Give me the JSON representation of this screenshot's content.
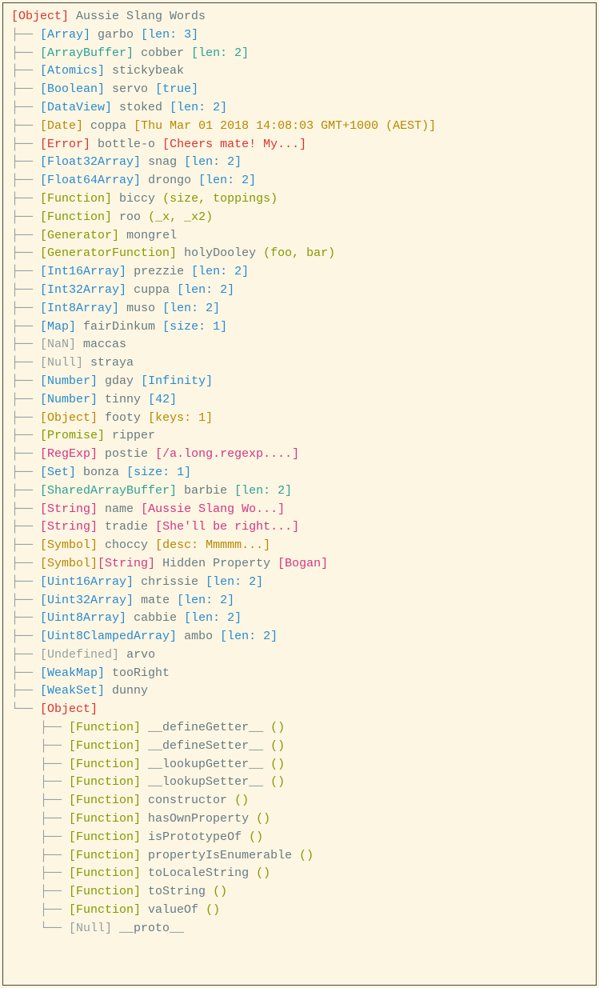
{
  "root": {
    "type": "[Object]",
    "label": "Aussie Slang Words"
  },
  "rows": [
    {
      "tree": "├── ",
      "typeClass": "type-array",
      "type": "[Array]",
      "key": "garbo",
      "valClass": "val-array",
      "val": "[len: 3]"
    },
    {
      "tree": "├── ",
      "typeClass": "type-arraybuffer",
      "type": "[ArrayBuffer]",
      "key": "cobber",
      "valClass": "val-buffer",
      "val": "[len: 2]"
    },
    {
      "tree": "├── ",
      "typeClass": "type-atomics",
      "type": "[Atomics]",
      "key": "stickybeak"
    },
    {
      "tree": "├── ",
      "typeClass": "type-boolean",
      "type": "[Boolean]",
      "key": "servo",
      "valClass": "val-bool",
      "val": "[true]"
    },
    {
      "tree": "├── ",
      "typeClass": "type-dataview",
      "type": "[DataView]",
      "key": "stoked",
      "valClass": "val-array",
      "val": "[len: 2]"
    },
    {
      "tree": "├── ",
      "typeClass": "type-date",
      "type": "[Date]",
      "key": "coppa",
      "valClass": "val-date",
      "val": "[Thu Mar 01 2018 14:08:03 GMT+1000 (AEST)]"
    },
    {
      "tree": "├── ",
      "typeClass": "type-error",
      "type": "[Error]",
      "key": "bottle-o",
      "valClass": "val-error",
      "val": "[Cheers mate! My...]"
    },
    {
      "tree": "├── ",
      "typeClass": "type-typed",
      "type": "[Float32Array]",
      "key": "snag",
      "valClass": "val-array",
      "val": "[len: 2]"
    },
    {
      "tree": "├── ",
      "typeClass": "type-typed",
      "type": "[Float64Array]",
      "key": "drongo",
      "valClass": "val-array",
      "val": "[len: 2]"
    },
    {
      "tree": "├── ",
      "typeClass": "type-func",
      "type": "[Function]",
      "key": "biccy",
      "argsClass": "args",
      "args": "(size, toppings)"
    },
    {
      "tree": "├── ",
      "typeClass": "type-func",
      "type": "[Function]",
      "key": "roo",
      "argsClass": "args",
      "args": "(_x, _x2)"
    },
    {
      "tree": "├── ",
      "typeClass": "type-gen",
      "type": "[Generator]",
      "key": "mongrel"
    },
    {
      "tree": "├── ",
      "typeClass": "type-gen",
      "type": "[GeneratorFunction]",
      "key": "holyDooley",
      "argsClass": "args",
      "args": "(foo, bar)"
    },
    {
      "tree": "├── ",
      "typeClass": "type-typed",
      "type": "[Int16Array]",
      "key": "prezzie",
      "valClass": "val-array",
      "val": "[len: 2]"
    },
    {
      "tree": "├── ",
      "typeClass": "type-typed",
      "type": "[Int32Array]",
      "key": "cuppa",
      "valClass": "val-array",
      "val": "[len: 2]"
    },
    {
      "tree": "├── ",
      "typeClass": "type-typed",
      "type": "[Int8Array]",
      "key": "muso",
      "valClass": "val-array",
      "val": "[len: 2]"
    },
    {
      "tree": "├── ",
      "typeClass": "type-map",
      "type": "[Map]",
      "key": "fairDinkum",
      "valClass": "val-array",
      "val": "[size: 1]"
    },
    {
      "tree": "├── ",
      "typeClass": "type-nan",
      "type": "[NaN]",
      "key": "maccas"
    },
    {
      "tree": "├── ",
      "typeClass": "type-null",
      "type": "[Null]",
      "key": "straya"
    },
    {
      "tree": "├── ",
      "typeClass": "type-number",
      "type": "[Number]",
      "key": "gday",
      "valClass": "val-num",
      "val": "[Infinity]"
    },
    {
      "tree": "├── ",
      "typeClass": "type-number",
      "type": "[Number]",
      "key": "tinny",
      "valClass": "val-num",
      "val": "[42]"
    },
    {
      "tree": "├── ",
      "typeClass": "type-date",
      "type": "[Object]",
      "key": "footy",
      "valClass": "val-obj",
      "val": "[keys: 1]"
    },
    {
      "tree": "├── ",
      "typeClass": "type-promise",
      "type": "[Promise]",
      "key": "ripper"
    },
    {
      "tree": "├── ",
      "typeClass": "type-regexp",
      "type": "[RegExp]",
      "key": "postie",
      "valClass": "val-regexp",
      "val": "[/a.long.regexp....]"
    },
    {
      "tree": "├── ",
      "typeClass": "type-set",
      "type": "[Set]",
      "key": "bonza",
      "valClass": "val-array",
      "val": "[size: 1]"
    },
    {
      "tree": "├── ",
      "typeClass": "type-sharedbuffer",
      "type": "[SharedArrayBuffer]",
      "key": "barbie",
      "valClass": "val-buffer",
      "val": "[len: 2]"
    },
    {
      "tree": "├── ",
      "typeClass": "type-string",
      "type": "[String]",
      "key": "name",
      "valClass": "val-string",
      "val": "[Aussie Slang Wo...]"
    },
    {
      "tree": "├── ",
      "typeClass": "type-string",
      "type": "[String]",
      "key": "tradie",
      "valClass": "val-string",
      "val": "[She'll be right...]"
    },
    {
      "tree": "├── ",
      "typeClass": "type-symbol",
      "type": "[Symbol]",
      "key": "choccy",
      "valClass": "val-symbol",
      "val": "[desc: Mmmmm...]"
    },
    {
      "tree": "├── ",
      "typeClass": "type-symbol",
      "type": "[Symbol]",
      "type2Class": "type-string",
      "type2": "[String]",
      "key": "Hidden Property",
      "valClass": "val-string",
      "val": "[Bogan]"
    },
    {
      "tree": "├── ",
      "typeClass": "type-typed",
      "type": "[Uint16Array]",
      "key": "chrissie",
      "valClass": "val-array",
      "val": "[len: 2]"
    },
    {
      "tree": "├── ",
      "typeClass": "type-typed",
      "type": "[Uint32Array]",
      "key": "mate",
      "valClass": "val-array",
      "val": "[len: 2]"
    },
    {
      "tree": "├── ",
      "typeClass": "type-typed",
      "type": "[Uint8Array]",
      "key": "cabbie",
      "valClass": "val-array",
      "val": "[len: 2]"
    },
    {
      "tree": "├── ",
      "typeClass": "type-typed",
      "type": "[Uint8ClampedArray]",
      "key": "ambo",
      "valClass": "val-array",
      "val": "[len: 2]"
    },
    {
      "tree": "├── ",
      "typeClass": "type-undef",
      "type": "[Undefined]",
      "key": "arvo"
    },
    {
      "tree": "├── ",
      "typeClass": "type-weak",
      "type": "[WeakMap]",
      "key": "tooRight"
    },
    {
      "tree": "├── ",
      "typeClass": "type-weak",
      "type": "[WeakSet]",
      "key": "dunny"
    },
    {
      "tree": "└── ",
      "typeClass": "type-object",
      "type": "[Object]"
    },
    {
      "tree": "    ├── ",
      "typeClass": "type-func",
      "type": "[Function]",
      "key": "__defineGetter__",
      "argsClass": "args",
      "args": "()"
    },
    {
      "tree": "    ├── ",
      "typeClass": "type-func",
      "type": "[Function]",
      "key": "__defineSetter__",
      "argsClass": "args",
      "args": "()"
    },
    {
      "tree": "    ├── ",
      "typeClass": "type-func",
      "type": "[Function]",
      "key": "__lookupGetter__",
      "argsClass": "args",
      "args": "()"
    },
    {
      "tree": "    ├── ",
      "typeClass": "type-func",
      "type": "[Function]",
      "key": "__lookupSetter__",
      "argsClass": "args",
      "args": "()"
    },
    {
      "tree": "    ├── ",
      "typeClass": "type-func",
      "type": "[Function]",
      "key": "constructor",
      "argsClass": "args",
      "args": "()"
    },
    {
      "tree": "    ├── ",
      "typeClass": "type-func",
      "type": "[Function]",
      "key": "hasOwnProperty",
      "argsClass": "args",
      "args": "()"
    },
    {
      "tree": "    ├── ",
      "typeClass": "type-func",
      "type": "[Function]",
      "key": "isPrototypeOf",
      "argsClass": "args",
      "args": "()"
    },
    {
      "tree": "    ├── ",
      "typeClass": "type-func",
      "type": "[Function]",
      "key": "propertyIsEnumerable",
      "argsClass": "args",
      "args": "()"
    },
    {
      "tree": "    ├── ",
      "typeClass": "type-func",
      "type": "[Function]",
      "key": "toLocaleString",
      "argsClass": "args",
      "args": "()"
    },
    {
      "tree": "    ├── ",
      "typeClass": "type-func",
      "type": "[Function]",
      "key": "toString",
      "argsClass": "args",
      "args": "()"
    },
    {
      "tree": "    ├── ",
      "typeClass": "type-func",
      "type": "[Function]",
      "key": "valueOf",
      "argsClass": "args",
      "args": "()"
    },
    {
      "tree": "    └── ",
      "typeClass": "type-null",
      "type": "[Null]",
      "key": "__proto__"
    }
  ]
}
